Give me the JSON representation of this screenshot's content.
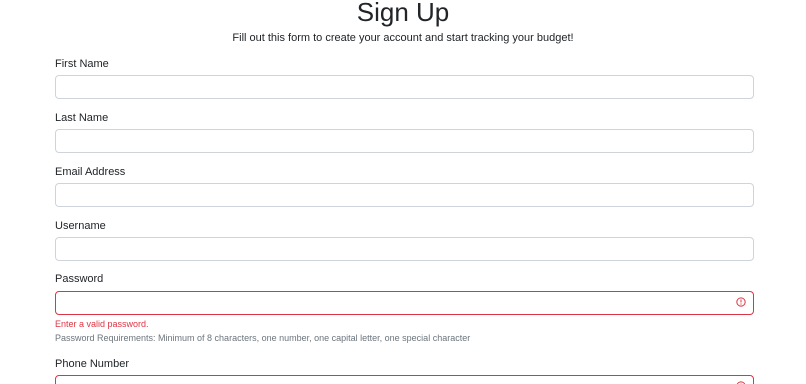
{
  "header": {
    "title": "Sign Up",
    "subtitle": "Fill out this form to create your account and start tracking your budget!"
  },
  "form": {
    "first_name": {
      "label": "First Name",
      "value": ""
    },
    "last_name": {
      "label": "Last Name",
      "value": ""
    },
    "email": {
      "label": "Email Address",
      "value": ""
    },
    "username": {
      "label": "Username",
      "value": ""
    },
    "password": {
      "label": "Password",
      "value": "",
      "error": "Enter a valid password.",
      "help": "Password Requirements: Minimum of 8 characters, one number, one capital letter, one special character"
    },
    "phone": {
      "label": "Phone Number",
      "value": ""
    }
  },
  "colors": {
    "error": "#dc3545",
    "border": "#ced4da",
    "muted": "#6c757d"
  },
  "icons": {
    "invalid": "exclamation-circle-icon"
  }
}
